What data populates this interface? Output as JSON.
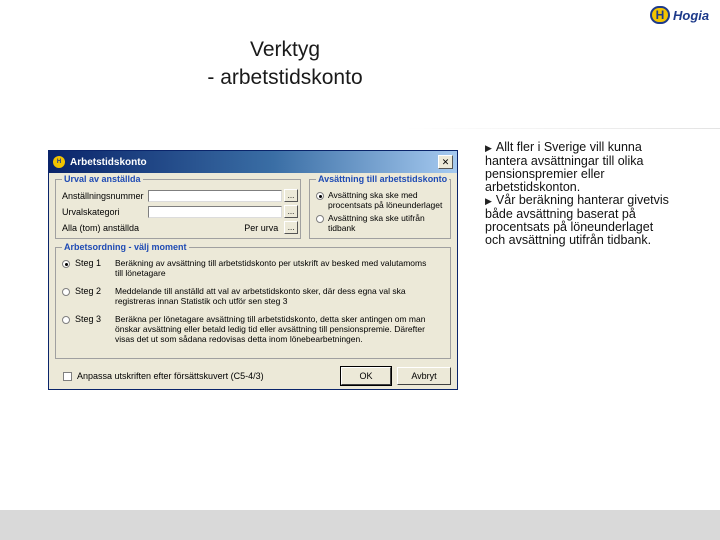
{
  "slide": {
    "title_line1": "Verktyg",
    "title_line2": "- arbetstidskonto",
    "logo_text": "Hogia",
    "logo_badge": "H"
  },
  "bullets": [
    {
      "marker": "▶",
      "text": "Allt fler i Sverige vill kunna hantera avsättningar till olika pensionspremier eller arbetstidskonton."
    },
    {
      "marker": "▶",
      "text": "Vår beräkning hanterar givetvis både avsättning baserat på procentsats på löneunderlaget och avsättning utifrån tidbank."
    }
  ],
  "dialog": {
    "title": "Arbetstidskonto",
    "icon_text": "H",
    "close_glyph": "✕",
    "selection": {
      "legend": "Urval av anställda",
      "fields": [
        {
          "label": "Anställningsnummer",
          "value": "",
          "button": "..."
        },
        {
          "label": "Urvalskategori",
          "value": "",
          "button": "..."
        }
      ],
      "all_label": "Alla (tom) anställda",
      "per_label": "Per urva",
      "per_button": "..."
    },
    "allocation": {
      "legend": "Avsättning till arbetstidskonto",
      "options": [
        {
          "label": "Avsättning ska ske med procentsats på löneunderlaget",
          "selected": true
        },
        {
          "label": "Avsättning ska ske utifrån tidbank",
          "selected": false
        }
      ]
    },
    "steps": {
      "legend": "Arbetsordning - välj moment",
      "items": [
        {
          "label": "Steg 1",
          "selected": true,
          "desc": "Beräkning av avsättning till arbetstidskonto per utskrift av besked med valutamoms till lönetagare"
        },
        {
          "label": "Steg 2",
          "selected": false,
          "desc": "Meddelande till anställd att val av arbetstidskonto sker, där dess egna val ska registreras innan Statistik och utför sen steg 3"
        },
        {
          "label": "Steg 3",
          "selected": false,
          "desc": "Beräkna per lönetagare avsättning till arbetstidskonto, detta sker antingen om man önskar avsättning eller betald ledig tid eller avsättning till pensionspremie. Därefter visas det ut som sådana redovisas detta inom lönebearbetningen."
        }
      ]
    },
    "print_checkbox": {
      "label": "Anpassa utskriften efter försättskuvert (C5-4/3)",
      "checked": false
    },
    "ok_label": "OK",
    "cancel_label": "Avbryt"
  }
}
